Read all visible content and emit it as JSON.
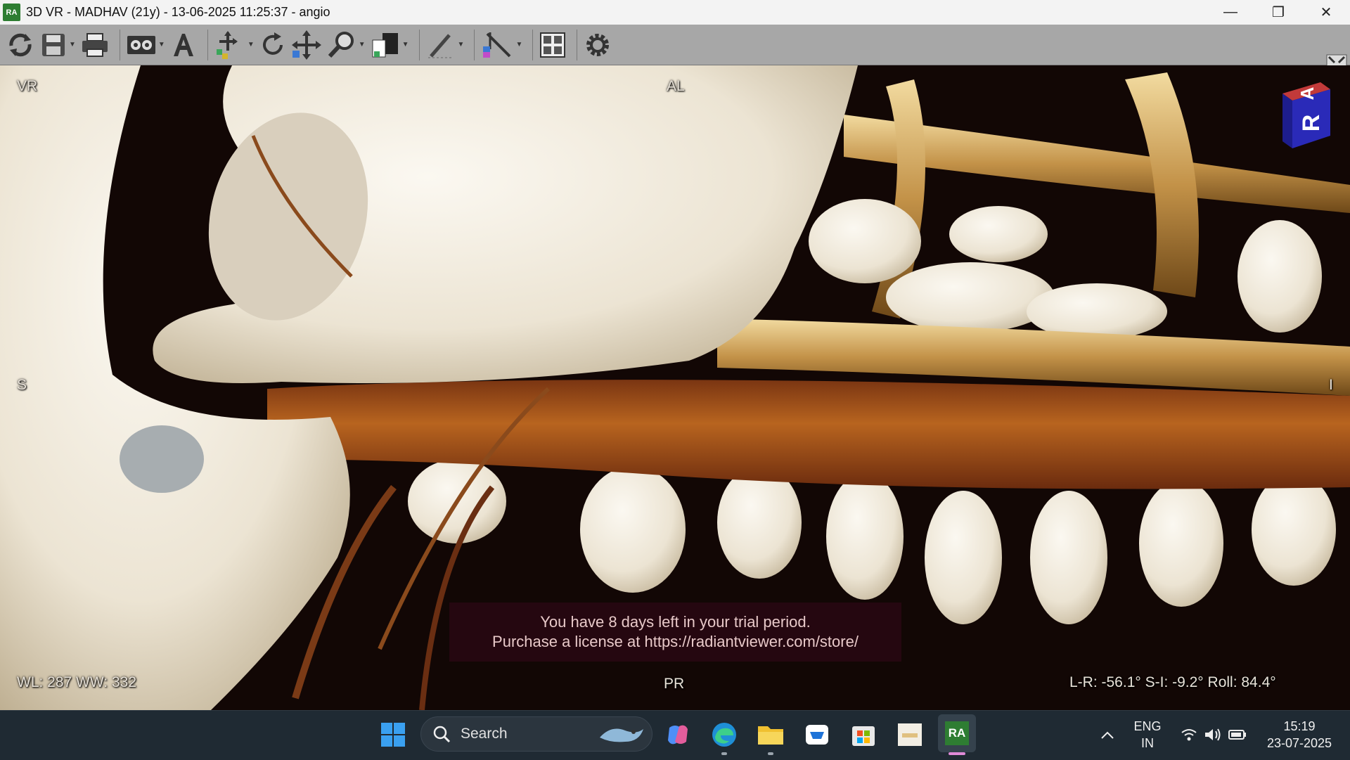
{
  "window": {
    "logo_text": "RA",
    "title": "3D VR - MADHAV (21y) - 13-06-2025 11:25:37 - angio",
    "controls": {
      "minimize": "—",
      "restore": "❐",
      "close": "✕"
    }
  },
  "toolbar": {
    "tools": [
      "refresh-icon",
      "save-icon",
      "print-icon",
      "cine-icon",
      "annotation-text-icon",
      "select-icon",
      "rotate-icon",
      "pan-icon",
      "zoom-icon",
      "window-level-icon",
      "draw-icon",
      "measure-icon",
      "layout-icon",
      "settings-icon"
    ]
  },
  "viewport": {
    "corner_labels": {
      "top_left": "VR",
      "top_center": "AL",
      "left_center": "S",
      "right_center": "I",
      "bottom_center": "PR"
    },
    "window_level": "WL: 287 WW: 332",
    "rotation": "L-R: -56.1° S-I: -9.2° Roll: 84.4°",
    "orientation_cube": {
      "front": "R",
      "top": "A"
    },
    "trial_notice": {
      "line1": "You have 8 days left in your trial period.",
      "line2": "Purchase a license at https://radiantviewer.com/store/"
    }
  },
  "taskbar": {
    "search_label": "Search",
    "pinned": [
      "windows-start-icon",
      "copilot-icon",
      "edge-icon",
      "file-explorer-icon",
      "store-bag-icon",
      "microsoft-store-icon",
      "notes-app-icon",
      "radiant-viewer-icon"
    ],
    "radiant_label": "RA",
    "tray": {
      "language": "ENG",
      "region": "IN",
      "time": "15:19",
      "date": "23-07-2025"
    }
  },
  "colors": {
    "toolbar_bg": "#a7a7a7",
    "titlebar_bg": "#f3f3f3",
    "taskbar_bg": "#1f2a33",
    "bone": "#efe9dc",
    "vessel": "#a4581f",
    "trial_bg": "#28081a"
  }
}
